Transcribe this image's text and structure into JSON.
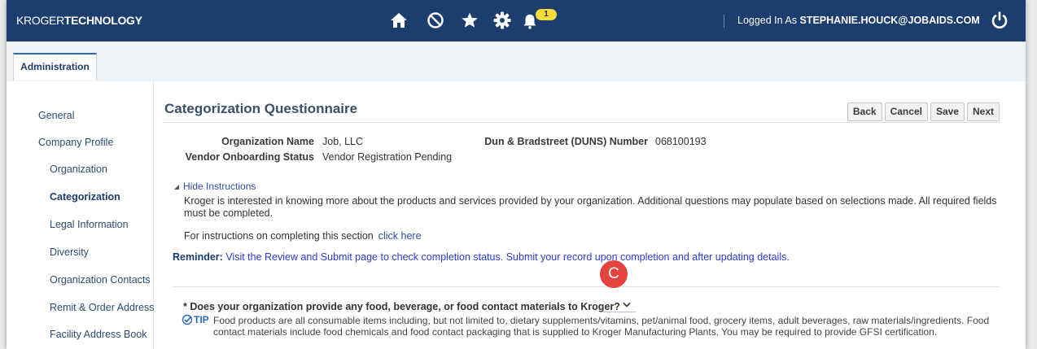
{
  "header": {
    "logo_part1": "KROGER",
    "logo_part2": "TECHNOLOGY",
    "notification_count": "1",
    "logged_in_label": "Logged In As",
    "user_email": "STEPHANIE.HOUCK@JOBAIDS.COM",
    "icons": [
      "home-icon",
      "blocked-icon",
      "star-icon",
      "gear-icon",
      "bell-icon",
      "power-icon"
    ]
  },
  "tabs": [
    {
      "label": "Administration"
    }
  ],
  "sidebar": {
    "items": [
      {
        "label": "General"
      },
      {
        "label": "Company Profile"
      },
      {
        "label": "Organization"
      },
      {
        "label": "Categorization"
      },
      {
        "label": "Legal Information"
      },
      {
        "label": "Diversity"
      },
      {
        "label": "Organization Contacts"
      },
      {
        "label": "Remit & Order Address"
      },
      {
        "label": "Facility Address Book"
      }
    ]
  },
  "page": {
    "title": "Categorization Questionnaire",
    "buttons": {
      "back": "Back",
      "cancel": "Cancel",
      "save": "Save",
      "next": "Next"
    },
    "org_name_label": "Organization Name",
    "org_name_value": "Job, LLC",
    "duns_label": "Dun & Bradstreet (DUNS) Number",
    "duns_value": "068100193",
    "status_label": "Vendor Onboarding Status",
    "status_value": "Vendor Registration Pending",
    "hide_instructions": "Hide Instructions",
    "instructions": "Kroger is interested in knowing more about the products and services provided by your organization. Additional questions may populate based on selections made. All required fields must be completed.",
    "for_instructions": "For instructions on completing this section",
    "click_here": "click here",
    "reminder_label": "Reminder:",
    "reminder_text": "Visit the Review and Submit page to check completion status. Submit your record upon completion and after updating details.",
    "question": "* Does your organization provide any food, beverage, or food contact materials to Kroger?",
    "tip_label": "TIP",
    "tip_text": "Food products are all consumable items including, but not limited to, dietary supplements/vitamins, pet/animal food, grocery items, adult beverages, raw materials/ingredients. Food contact materials include food chemicals and food contact packaging that is supplied to Kroger Manufacturing Plants. You may be required to provide GFSI certification.",
    "callout_letter": "C"
  },
  "colors": {
    "header_bg": "#1c3e6e",
    "link": "#2b4d9e",
    "reminder": "#2b3ad0",
    "badge": "#f5dc3a",
    "callout": "#e6433e"
  }
}
